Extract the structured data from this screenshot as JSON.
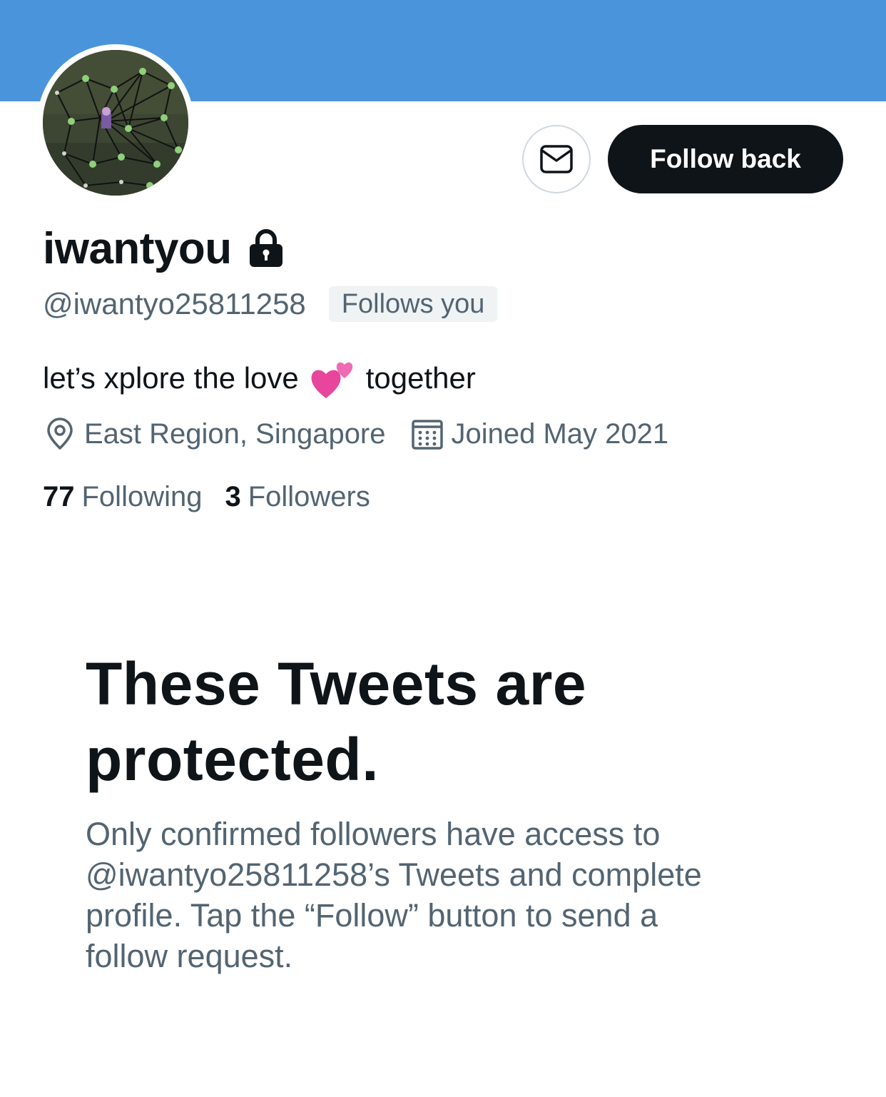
{
  "colors": {
    "banner": "#4a94dc",
    "primary_text": "#0f1419",
    "secondary_text": "#536471",
    "badge_bg": "#eff3f4",
    "follow_button_bg": "#0f1419",
    "follow_button_text": "#ffffff"
  },
  "actions": {
    "message_icon": "mail-icon",
    "follow_label": "Follow back"
  },
  "profile": {
    "display_name": "iwantyou",
    "protected_icon": "lock-icon",
    "handle": "@iwantyo25811258",
    "follows_you": "Follows you",
    "bio_before": "let’s xplore the love",
    "bio_emoji": "💕",
    "bio_after": "together",
    "location": "East Region, Singapore",
    "location_icon": "location-pin-icon",
    "joined": "Joined May 2021",
    "joined_icon": "calendar-icon",
    "following_count": "77",
    "following_label": "Following",
    "followers_count": "3",
    "followers_label": "Followers"
  },
  "protected_notice": {
    "title_line1": "These Tweets are",
    "title_line2": "protected.",
    "body_line1": "Only confirmed followers have access to",
    "body_line2": "@iwantyo25811258’s Tweets and complete",
    "body_line3": "profile. Tap the “Follow” button to send a",
    "body_line4": "follow request."
  }
}
